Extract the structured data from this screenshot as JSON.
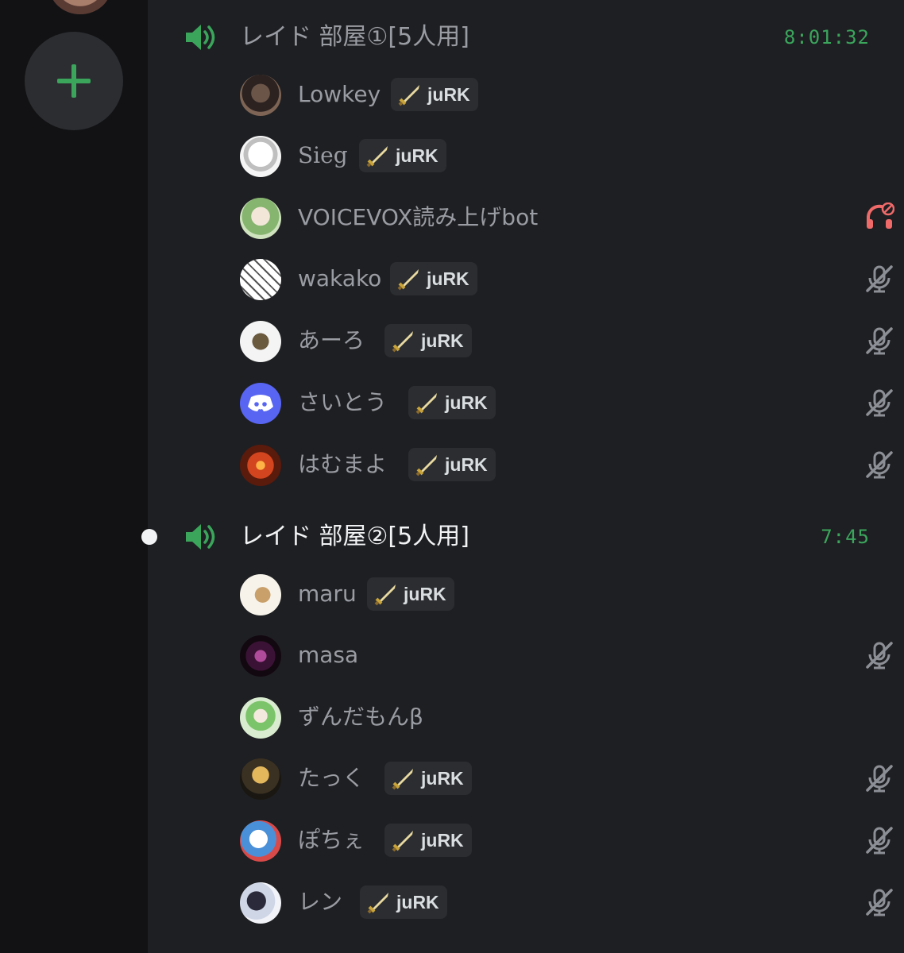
{
  "sidebar": {
    "add_server_icon": "plus-icon"
  },
  "channels": [
    {
      "name": "レイド 部屋①[5人用]",
      "timer": "8:01:32",
      "active": false,
      "members": [
        {
          "name": "Lowkey",
          "tag": "juRK",
          "status": "none"
        },
        {
          "name": "Sieg",
          "tag": "juRK",
          "status": "none"
        },
        {
          "name": "VOICEVOX読み上げbot",
          "tag": "",
          "status": "deafened"
        },
        {
          "name": "wakako",
          "tag": "juRK",
          "status": "muted"
        },
        {
          "name": "あーろ",
          "tag": "juRK",
          "status": "muted"
        },
        {
          "name": "さいとう",
          "tag": "juRK",
          "status": "muted"
        },
        {
          "name": "はむまよ",
          "tag": "juRK",
          "status": "muted"
        }
      ]
    },
    {
      "name": "レイド 部屋②[5人用]",
      "timer": "7:45",
      "active": true,
      "members": [
        {
          "name": "maru",
          "tag": "juRK",
          "status": "none"
        },
        {
          "name": "masa",
          "tag": "",
          "status": "muted"
        },
        {
          "name": "ずんだもんβ",
          "tag": "",
          "status": "none"
        },
        {
          "name": "たっく",
          "tag": "juRK",
          "status": "muted"
        },
        {
          "name": "ぽちぇ",
          "tag": "juRK",
          "status": "muted"
        },
        {
          "name": "レン",
          "tag": "juRK",
          "status": "muted"
        }
      ]
    }
  ],
  "colors": {
    "accent_green": "#3ba55c",
    "deafen_red": "#f06a6a",
    "muted_text": "#9a9ca3"
  }
}
